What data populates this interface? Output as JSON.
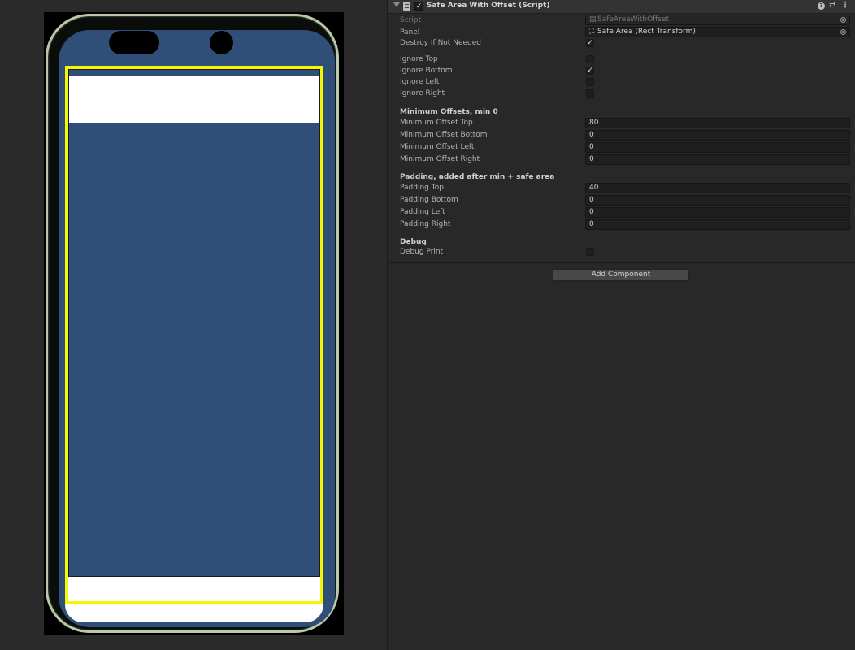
{
  "inspector": {
    "component_title": "Safe Area With Offset (Script)",
    "enabled_check": "✓",
    "icons": {
      "fold": "fold-arrow-icon",
      "script": "script-file-icon",
      "help": "help-icon",
      "presets": "presets-icon",
      "more": "more-options-icon",
      "help_glyph": "?",
      "presets_glyph": "⇄",
      "more_glyph": "⋮",
      "rect_transform_glyph": "⛶",
      "script_file_glyph": "▤"
    },
    "script": {
      "label": "Script",
      "value": "SafeAreaWithOffset"
    },
    "panel": {
      "label": "Panel",
      "value": "Safe Area (Rect Transform)"
    },
    "destroy_if_not_needed": {
      "label": "Destroy If Not Needed",
      "checked": true,
      "mark": "✓"
    },
    "ignore": [
      {
        "label": "Ignore Top",
        "checked": false,
        "mark": ""
      },
      {
        "label": "Ignore Bottom",
        "checked": true,
        "mark": "✓"
      },
      {
        "label": "Ignore Left",
        "checked": false,
        "mark": ""
      },
      {
        "label": "Ignore Right",
        "checked": false,
        "mark": ""
      }
    ],
    "min_offsets": {
      "header": "Minimum Offsets, min 0",
      "fields": [
        {
          "label": "Minimum Offset Top",
          "value": "80"
        },
        {
          "label": "Minimum Offset Bottom",
          "value": "0"
        },
        {
          "label": "Minimum Offset Left",
          "value": "0"
        },
        {
          "label": "Minimum Offset Right",
          "value": "0"
        }
      ]
    },
    "padding": {
      "header": "Padding, added after min + safe area",
      "fields": [
        {
          "label": "Padding Top",
          "value": "40"
        },
        {
          "label": "Padding Bottom",
          "value": "0"
        },
        {
          "label": "Padding Left",
          "value": "0"
        },
        {
          "label": "Padding Right",
          "value": "0"
        }
      ]
    },
    "debug": {
      "header": "Debug",
      "print": {
        "label": "Debug Print",
        "checked": false,
        "mark": ""
      }
    },
    "add_component_label": "Add Component"
  },
  "game_view": {
    "colors": {
      "background": "#2a2a2a",
      "screen": "#2f4f78",
      "safe_area_outline": "#f4f700",
      "panel": "#ffffff"
    }
  }
}
